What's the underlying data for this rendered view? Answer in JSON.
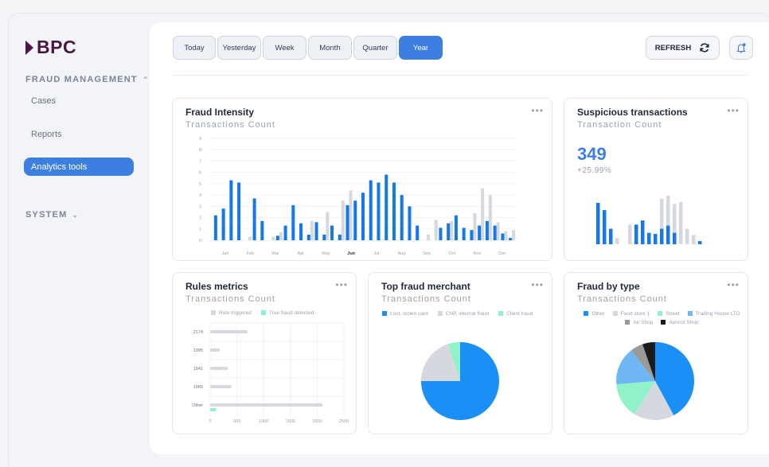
{
  "brand": {
    "name": "BPC"
  },
  "sidebar": {
    "sections": [
      {
        "label": "FRAUD MANAGEMENT",
        "expanded": true
      },
      {
        "label": "SYSTEM",
        "expanded": false
      }
    ],
    "items": [
      {
        "label": "Cases",
        "active": false
      },
      {
        "label": "Reports",
        "active": false
      },
      {
        "label": "Analytics tools",
        "active": true
      }
    ]
  },
  "toolbar": {
    "periods": [
      "Today",
      "Yesterday",
      "Week",
      "Month",
      "Quarter",
      "Year"
    ],
    "active_period": "Year",
    "refresh_label": "REFRESH"
  },
  "colors": {
    "accent": "#3d7fe0",
    "bar_blue": "#1478e6",
    "bar_grey": "#d5d9df",
    "mint": "#8ff2c8",
    "brand": "#4a1745"
  },
  "cards": {
    "fraud_intensity": {
      "title": "Fraud Intensity",
      "subtitle": "Transactions Count",
      "menu": "•••"
    },
    "suspicious": {
      "title": "Suspicious transactions",
      "subtitle": "Transaction Count",
      "value": "349",
      "change": "+25.99%",
      "menu": "•••"
    },
    "rules": {
      "title": "Rules metrics",
      "subtitle": "Transactions Count",
      "menu": "•••"
    },
    "merchant": {
      "title": "Top fraud merchant",
      "subtitle": "Transactions Count",
      "menu": "•••"
    },
    "fraud_type": {
      "title": "Fraud by type",
      "subtitle": "Transactions Count",
      "menu": "•••"
    }
  },
  "chart_data": [
    {
      "id": "fraud_intensity",
      "type": "bar",
      "x_ticks": [
        "Jan",
        "Feb",
        "Mar",
        "Apr",
        "May",
        "Jun",
        "Jul",
        "Aug",
        "Sep",
        "Oct",
        "Nov",
        "Dec"
      ],
      "highlight_tick": "Jun",
      "y_ticks": [
        "0",
        "1",
        "2",
        "3",
        "4",
        "5",
        "6",
        "7",
        "8",
        "9"
      ],
      "ylim": [
        0,
        9
      ],
      "series": [
        {
          "color": "blue",
          "values": [
            2.2,
            2.8,
            5.3,
            5.1,
            0,
            3.7,
            1.7,
            0,
            0.4,
            1.3,
            3.1,
            1.5,
            0.5,
            1.6,
            0.5,
            1.3,
            0.5,
            3.1,
            3.5,
            4.2,
            5.3,
            5.1,
            5.8,
            5.1,
            4.0,
            3.0,
            1.3,
            0,
            0,
            1.1,
            1.5,
            2.2,
            1.1,
            0.9,
            1.3,
            1.7,
            1.3,
            0.6,
            0.2
          ]
        },
        {
          "color": "grey",
          "values": [
            0,
            0,
            0,
            0,
            0.3,
            0,
            0,
            0.3,
            0.7,
            0,
            0,
            0,
            1.7,
            0,
            2.5,
            0,
            3.5,
            4.4,
            0,
            0,
            0,
            0,
            0,
            0,
            0,
            0,
            0,
            0.5,
            1.8,
            0,
            1.7,
            0,
            0,
            2.4,
            4.6,
            4.0,
            1.6,
            0.8,
            0.9
          ]
        }
      ]
    },
    {
      "id": "suspicious",
      "type": "bar",
      "series": [
        {
          "color": "blue",
          "values": [
            4.0,
            3.3,
            1.5,
            0,
            0,
            0,
            1.9,
            2.3,
            1.1,
            1.0,
            1.5,
            1.8,
            1.1,
            0,
            0,
            0,
            0.3
          ]
        },
        {
          "color": "grey",
          "values": [
            0,
            0,
            0,
            0.6,
            0,
            1.9,
            0,
            0,
            0,
            0,
            4.4,
            4.7,
            3.9,
            4.1,
            1.5,
            0.9,
            0
          ]
        }
      ]
    },
    {
      "id": "rules",
      "type": "bar",
      "orientation": "horizontal",
      "categories": [
        "2174",
        "1995",
        "1941",
        "1965",
        "Other"
      ],
      "x_ticks": [
        "0",
        "500",
        "1000",
        "1500",
        "2000",
        "2500"
      ],
      "xlim": [
        0,
        2500
      ],
      "series": [
        {
          "name": "Rule triggered",
          "color": "#d5d9df",
          "values": [
            700,
            180,
            330,
            400,
            2100
          ]
        },
        {
          "name": "True fraud detected",
          "color": "#8ff2c8",
          "values": [
            0,
            0,
            0,
            0,
            110
          ]
        }
      ]
    },
    {
      "id": "merchant",
      "type": "pie",
      "legend": [
        {
          "label": "Lost, stolen card",
          "color": "#1a8ff5",
          "value": 75
        },
        {
          "label": "CNP, internal fraud",
          "color": "#d5d9df",
          "value": 20
        },
        {
          "label": "Client fraud",
          "color": "#8ff2c8",
          "value": 5
        }
      ]
    },
    {
      "id": "fraud_type",
      "type": "pie",
      "legend": [
        {
          "label": "Other",
          "color": "#1a8ff5",
          "value": 40
        },
        {
          "label": "Food store 1",
          "color": "#d5d9df",
          "value": 16
        },
        {
          "label": "Street",
          "color": "#8ff2c8",
          "value": 14
        },
        {
          "label": "Trading House LTD",
          "color": "#6fb7f2",
          "value": 15
        },
        {
          "label": "Air Shop",
          "color": "#9a9a9a",
          "value": 5
        },
        {
          "label": "Apricot Shop",
          "color": "#1b1b1b",
          "value": 5
        }
      ]
    }
  ]
}
